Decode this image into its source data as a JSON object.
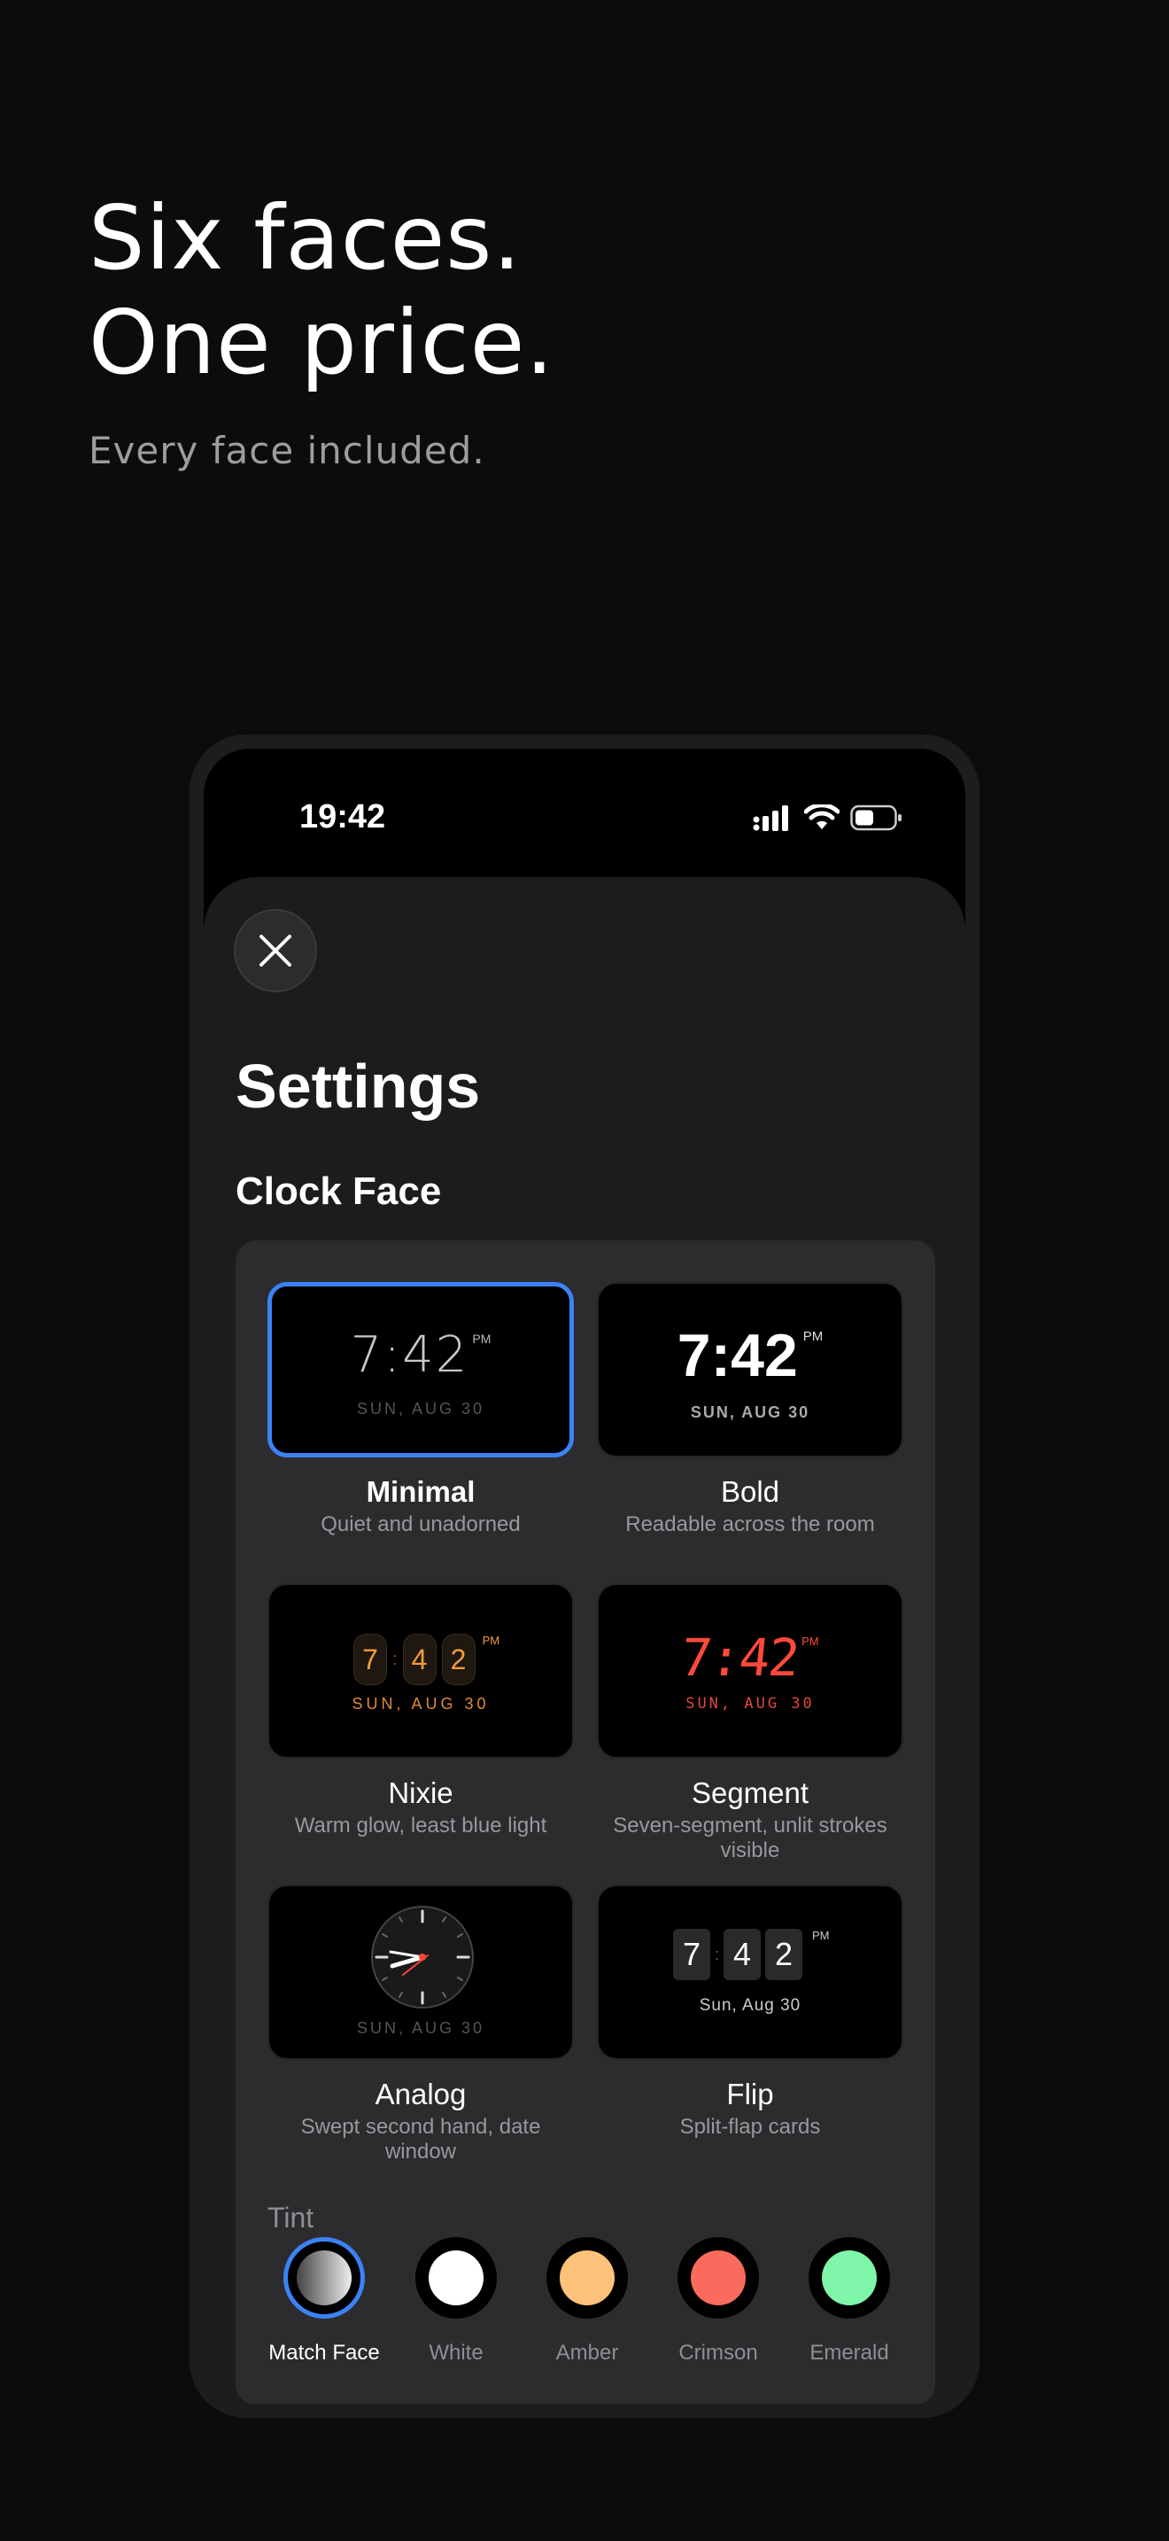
{
  "hero": {
    "title_line1": "Six faces.",
    "title_line2": "One price.",
    "subtitle": "Every face included."
  },
  "status_bar": {
    "time": "19:42"
  },
  "settings": {
    "title": "Settings",
    "section": "Clock Face",
    "close_icon": "close-icon",
    "faces": [
      {
        "name": "Minimal",
        "description": "Quiet and unadorned",
        "selected": true,
        "preview": {
          "time": "7:42",
          "ampm": "PM",
          "date": "SUN, AUG 30"
        }
      },
      {
        "name": "Bold",
        "description": "Readable across the room",
        "selected": false,
        "preview": {
          "time": "7:42",
          "ampm": "PM",
          "date": "SUN, AUG 30"
        }
      },
      {
        "name": "Nixie",
        "description": "Warm glow, least blue light",
        "selected": false,
        "preview": {
          "d1": "7",
          "d2": "4",
          "d3": "2",
          "ampm": "PM",
          "date": "SUN, AUG 30"
        }
      },
      {
        "name": "Segment",
        "description": "Seven-segment, unlit strokes visible",
        "selected": false,
        "preview": {
          "time": "7:42",
          "ampm": "PM",
          "date": "SUN, AUG 30"
        }
      },
      {
        "name": "Analog",
        "description": "Swept second hand, date window",
        "selected": false,
        "preview": {
          "date": "SUN, AUG 30"
        }
      },
      {
        "name": "Flip",
        "description": "Split-flap cards",
        "selected": false,
        "preview": {
          "d1": "7",
          "d2": "4",
          "d3": "2",
          "ampm": "PM",
          "date": "Sun, Aug 30"
        }
      }
    ],
    "tint": {
      "label": "Tint",
      "options": [
        {
          "name": "Match Face",
          "color": "#9a9a9a",
          "selected": true
        },
        {
          "name": "White",
          "color": "#ffffff",
          "selected": false
        },
        {
          "name": "Amber",
          "color": "#ffc27a",
          "selected": false
        },
        {
          "name": "Crimson",
          "color": "#fb6b5d",
          "selected": false
        },
        {
          "name": "Emerald",
          "color": "#7ef5a8",
          "selected": false
        }
      ]
    }
  },
  "colors": {
    "accent": "#3b82f6",
    "nixie": "#f59a3c",
    "segment": "#ff4a3a"
  }
}
